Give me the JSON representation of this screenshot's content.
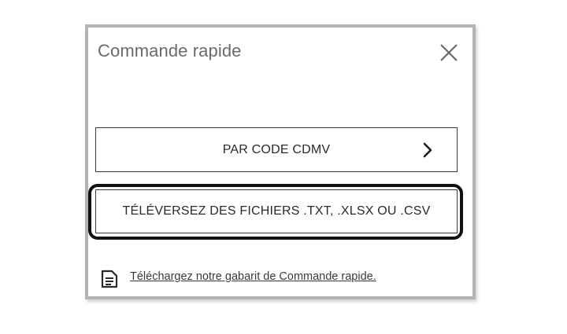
{
  "dialog": {
    "title": "Commande rapide",
    "close_icon": "close-icon"
  },
  "options": {
    "cdmv_label": "PAR CODE CDMV",
    "cdmv_icon": "chevron-right-icon",
    "upload_label": "TÉLÉVERSEZ DES FICHIERS .TXT, .XLSX OU .CSV"
  },
  "template": {
    "icon": "document-icon",
    "link_text": "Téléchargez notre gabarit de Commande rapide."
  },
  "colors": {
    "panel_border": "#b4b4b4",
    "highlight_ring": "#111111",
    "text": "#2a2a2a",
    "title": "#6a6a6a"
  }
}
